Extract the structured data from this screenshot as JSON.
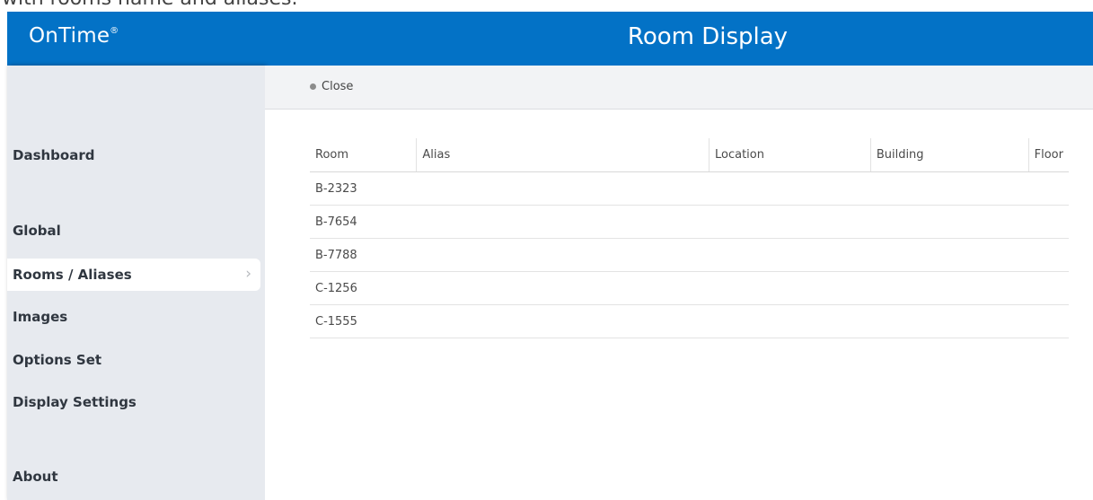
{
  "caption": "with rooms name and aliases.",
  "header": {
    "logo": "OnTime",
    "logo_mark": "®",
    "title": "Room Display"
  },
  "sidebar": {
    "items": [
      {
        "label": "Dashboard"
      },
      {
        "label": "Global"
      },
      {
        "label": "Rooms / Aliases",
        "active": true
      },
      {
        "label": "Images"
      },
      {
        "label": "Options Set"
      },
      {
        "label": "Display Settings"
      },
      {
        "label": "About"
      }
    ],
    "active_chevron": "chevron-right-icon"
  },
  "toolbar": {
    "close_label": "Close"
  },
  "table": {
    "columns": [
      "Room",
      "Alias",
      "Location",
      "Building",
      "Floor"
    ],
    "rows": [
      [
        "B-2323",
        "",
        "",
        "",
        ""
      ],
      [
        "B-7654",
        "",
        "",
        "",
        ""
      ],
      [
        "B-7788",
        "",
        "",
        "",
        ""
      ],
      [
        "C-1256",
        "",
        "",
        "",
        ""
      ],
      [
        "C-1555",
        "",
        "",
        "",
        ""
      ]
    ]
  },
  "colors": {
    "header_bg": "#0372c6",
    "sidebar_bg": "#e7eaef",
    "toolbar_bg": "#f2f3f5"
  }
}
